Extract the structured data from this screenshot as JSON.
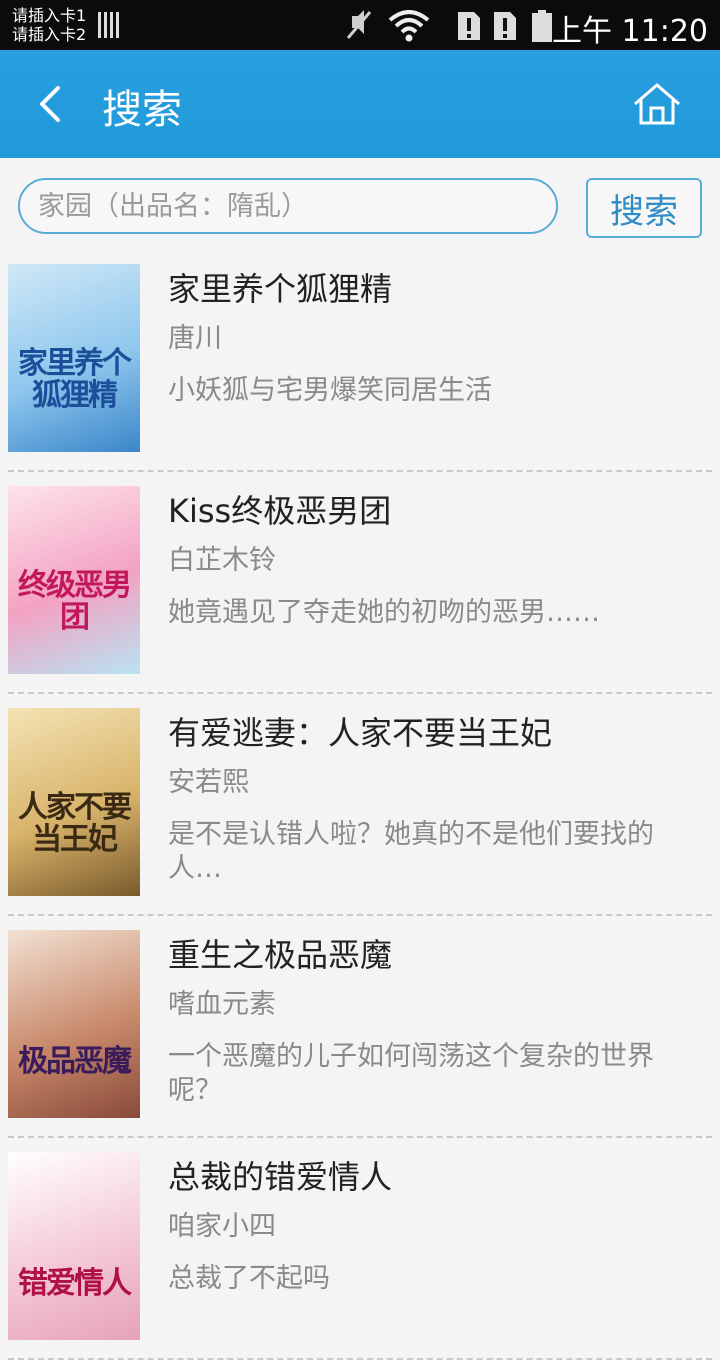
{
  "status_bar": {
    "sim1": "请插入卡1",
    "sim2": "请插入卡2",
    "time": "上午 11:20",
    "icons": [
      "signal-bars-icon",
      "mute-icon",
      "wifi-icon",
      "sim-alert-icon",
      "sim-alert-icon",
      "battery-icon"
    ]
  },
  "header": {
    "title": "搜索",
    "back_icon": "chevron-left-icon",
    "home_icon": "home-icon"
  },
  "search": {
    "placeholder": "家园（出品名：隋乱）",
    "button_label": "搜索"
  },
  "books": [
    {
      "title": "家里养个狐狸精",
      "author": "唐川",
      "desc": "小妖狐与宅男爆笑同居生活",
      "cover_text": "家里养个狐狸精",
      "cover_colors": [
        "#cfe8f6",
        "#8fc7ee",
        "#3b86c9"
      ],
      "cover_text_color": "#1c4f9a"
    },
    {
      "title": "Kiss终极恶男团",
      "author": "白芷木铃",
      "desc": "她竟遇见了夺走她的初吻的恶男……",
      "cover_text": "终级恶男团",
      "cover_colors": [
        "#fde3ec",
        "#f3a2c2",
        "#b8e3f2"
      ],
      "cover_text_color": "#c2185b"
    },
    {
      "title": "有爱逃妻：人家不要当王妃",
      "author": "安若熙",
      "desc": "是不是认错人啦？她真的不是他们要找的人…",
      "cover_text": "人家不要当王妃",
      "cover_colors": [
        "#f4e3b4",
        "#d8b46a",
        "#7a5a2c"
      ],
      "cover_text_color": "#3a2a14"
    },
    {
      "title": "重生之极品恶魔",
      "author": "嗜血元素",
      "desc": "一个恶魔的儿子如何闯荡这个复杂的世界呢？",
      "cover_text": "极品恶魔",
      "cover_colors": [
        "#f2e1d3",
        "#c98a6c",
        "#8a4a3a"
      ],
      "cover_text_color": "#3a1c5c"
    },
    {
      "title": "总裁的错爱情人",
      "author": "咱家小四",
      "desc": "总裁了不起吗",
      "cover_text": "错爱情人",
      "cover_colors": [
        "#ffffff",
        "#f4c9d6",
        "#e6a2b9"
      ],
      "cover_text_color": "#b01048"
    }
  ]
}
